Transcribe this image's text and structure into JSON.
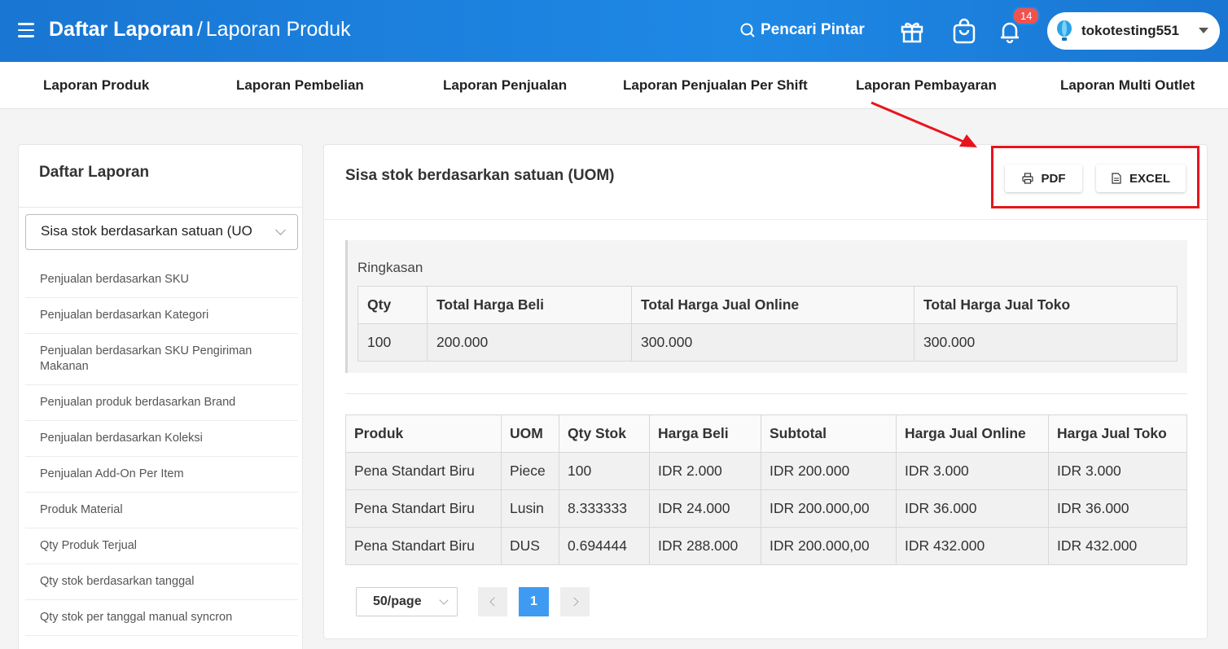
{
  "header": {
    "title_bold": "Daftar Laporan",
    "title_sep": "/",
    "title_sub": "Laporan Produk",
    "smart_search": "Pencari Pintar",
    "notification_count": "14",
    "account_name": "tokotesting551",
    "icons": [
      "menu-icon",
      "search-icon",
      "gift-icon",
      "shopping-bag-icon",
      "bell-icon",
      "balloon-logo-icon"
    ]
  },
  "subnav": {
    "tabs": [
      {
        "label": "Laporan Produk"
      },
      {
        "label": "Laporan Pembelian"
      },
      {
        "label": "Laporan Penjualan"
      },
      {
        "label": "Laporan Penjualan Per Shift"
      },
      {
        "label": "Laporan Pembayaran"
      },
      {
        "label": "Laporan Multi Outlet"
      }
    ]
  },
  "sidebar": {
    "title": "Daftar Laporan",
    "selected": "Sisa stok berdasarkan satuan (UO",
    "items": [
      {
        "label": "Penjualan berdasarkan SKU"
      },
      {
        "label": "Penjualan berdasarkan Kategori"
      },
      {
        "label": "Penjualan berdasarkan SKU Pengiriman Makanan"
      },
      {
        "label": "Penjualan produk berdasarkan Brand"
      },
      {
        "label": "Penjualan berdasarkan Koleksi"
      },
      {
        "label": "Penjualan Add-On Per Item"
      },
      {
        "label": "Produk Material"
      },
      {
        "label": "Qty Produk Terjual"
      },
      {
        "label": "Qty stok berdasarkan tanggal"
      },
      {
        "label": "Qty stok per tanggal manual syncron"
      }
    ]
  },
  "main": {
    "title": "Sisa stok berdasarkan satuan (UOM)",
    "pdf_label": "PDF",
    "excel_label": "EXCEL",
    "summary": {
      "label": "Ringkasan",
      "headers": [
        "Qty",
        "Total Harga Beli",
        "Total Harga Jual Online",
        "Total Harga Jual Toko"
      ],
      "row": [
        "100",
        "200.000",
        "300.000",
        "300.000"
      ]
    },
    "table": {
      "headers": [
        "Produk",
        "UOM",
        "Qty Stok",
        "Harga Beli",
        "Subtotal",
        "Harga Jual Online",
        "Harga Jual Toko"
      ],
      "rows": [
        [
          "Pena Standart Biru",
          "Piece",
          "100",
          "IDR 2.000",
          "IDR 200.000",
          "IDR 3.000",
          "IDR 3.000"
        ],
        [
          "Pena Standart Biru",
          "Lusin",
          "8.333333",
          "IDR 24.000",
          "IDR 200.000,00",
          "IDR 36.000",
          "IDR 36.000"
        ],
        [
          "Pena Standart Biru",
          "DUS",
          "0.694444",
          "IDR 288.000",
          "IDR 200.000,00",
          "IDR 432.000",
          "IDR 432.000"
        ]
      ]
    },
    "pagination": {
      "page_size": "50/page",
      "current_page": "1"
    }
  },
  "colors": {
    "header_blue": "#1e88e5",
    "highlight_red": "#e8141c",
    "badge_red": "#ef5350",
    "page_active": "#3f9bf2"
  }
}
